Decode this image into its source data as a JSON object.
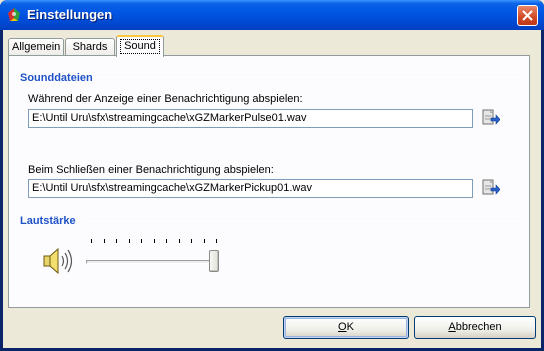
{
  "window": {
    "title": "Einstellungen",
    "close_label": "Schließen"
  },
  "tabs": [
    {
      "label": "Allgemein",
      "active": false
    },
    {
      "label": "Shards",
      "active": false
    },
    {
      "label": "Sound",
      "active": true
    }
  ],
  "sounddateien": {
    "title": "Sounddateien",
    "notify_label": "Während der Anzeige einer Benachrichtigung abspielen:",
    "notify_value": "E:\\Until Uru\\sfx\\streamingcache\\xGZMarkerPulse01.wav",
    "close_label": "Beim Schließen einer Benachrichtigung abspielen:",
    "close_value": "E:\\Until Uru\\sfx\\streamingcache\\xGZMarkerPickup01.wav"
  },
  "lautstaerke": {
    "title": "Lautstärke",
    "volume_fraction": 1.0,
    "tick_count": 11
  },
  "buttons": {
    "ok_prefix": "",
    "ok_mnemonic": "O",
    "ok_rest": "K",
    "cancel_mnemonic": "A",
    "cancel_rest": "bbrechen"
  },
  "colors": {
    "group_title": "#1f52c8",
    "title_bar": "#0055e3",
    "panel_bg": "#fcfcfe",
    "dialog_bg": "#ece9d8"
  }
}
